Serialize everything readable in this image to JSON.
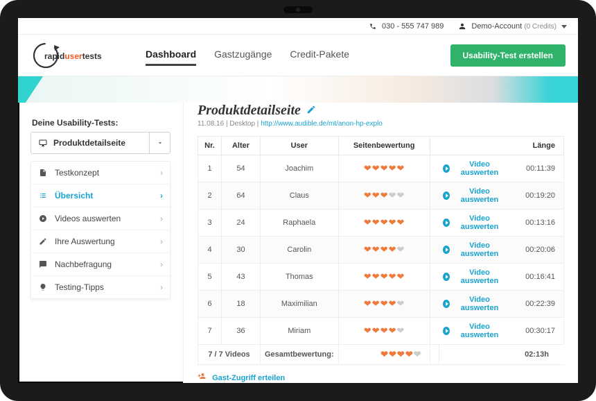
{
  "topbar": {
    "phone": "030 - 555 747 989",
    "account_name": "Demo-Account",
    "credits": "(0 Credits)"
  },
  "brand": {
    "a": "rapid",
    "b": "user",
    "c": "tests"
  },
  "nav": {
    "dashboard": "Dashboard",
    "guest": "Gastzugänge",
    "credits": "Credit-Pakete"
  },
  "cta_label": "Usability-Test erstellen",
  "sidebar": {
    "title": "Deine Usability-Tests:",
    "selected": "Produktdetailseite",
    "items": [
      {
        "label": "Testkonzept"
      },
      {
        "label": "Übersicht"
      },
      {
        "label": "Videos auswerten"
      },
      {
        "label": "Ihre Auswertung"
      },
      {
        "label": "Nachbefragung"
      },
      {
        "label": "Testing-Tipps"
      }
    ]
  },
  "page": {
    "title": "Produktdetailseite",
    "date": "11.08.16",
    "device": "Desktop",
    "url": "http://www.audible.de/mt/anon-hp-explo"
  },
  "table": {
    "headers": {
      "nr": "Nr.",
      "age": "Alter",
      "user": "User",
      "rating": "Seitenbewertung",
      "len": "Länge"
    },
    "action_label": "Video auswerten",
    "rows": [
      {
        "nr": "1",
        "age": "54",
        "user": "Joachim",
        "rating": 5,
        "len": "00:11:39"
      },
      {
        "nr": "2",
        "age": "64",
        "user": "Claus",
        "rating": 3,
        "len": "00:19:20"
      },
      {
        "nr": "3",
        "age": "24",
        "user": "Raphaela",
        "rating": 5,
        "len": "00:13:16"
      },
      {
        "nr": "4",
        "age": "30",
        "user": "Carolin",
        "rating": 4,
        "len": "00:20:06"
      },
      {
        "nr": "5",
        "age": "43",
        "user": "Thomas",
        "rating": 5,
        "len": "00:16:41"
      },
      {
        "nr": "6",
        "age": "18",
        "user": "Maximilian",
        "rating": 4,
        "len": "00:22:39"
      },
      {
        "nr": "7",
        "age": "36",
        "user": "Miriam",
        "rating": 4,
        "len": "00:30:17"
      }
    ],
    "summary": {
      "count": "7 / 7 Videos",
      "label": "Gesamtbewertung:",
      "rating": 4,
      "total": "02:13h"
    }
  },
  "guest_link": "Gast-Zugriff erteilen"
}
